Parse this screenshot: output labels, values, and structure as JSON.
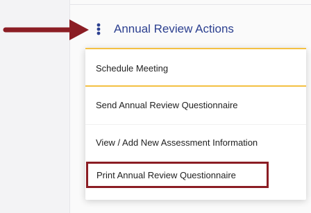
{
  "header": {
    "label": "Annual Review Actions",
    "icon": "kebab-vertical-icon"
  },
  "menu": {
    "items": [
      {
        "label": "Schedule Meeting"
      },
      {
        "label": "Send Annual Review Questionnaire"
      },
      {
        "label": "View / Add New Assessment Information"
      },
      {
        "label": "Print Annual Review Questionnaire",
        "highlighted": true
      }
    ]
  },
  "colors": {
    "header_text": "#2b3f8f",
    "arrow": "#8b1d24",
    "highlight_border": "#8b1d24",
    "menu_accent": "#f3c042"
  }
}
